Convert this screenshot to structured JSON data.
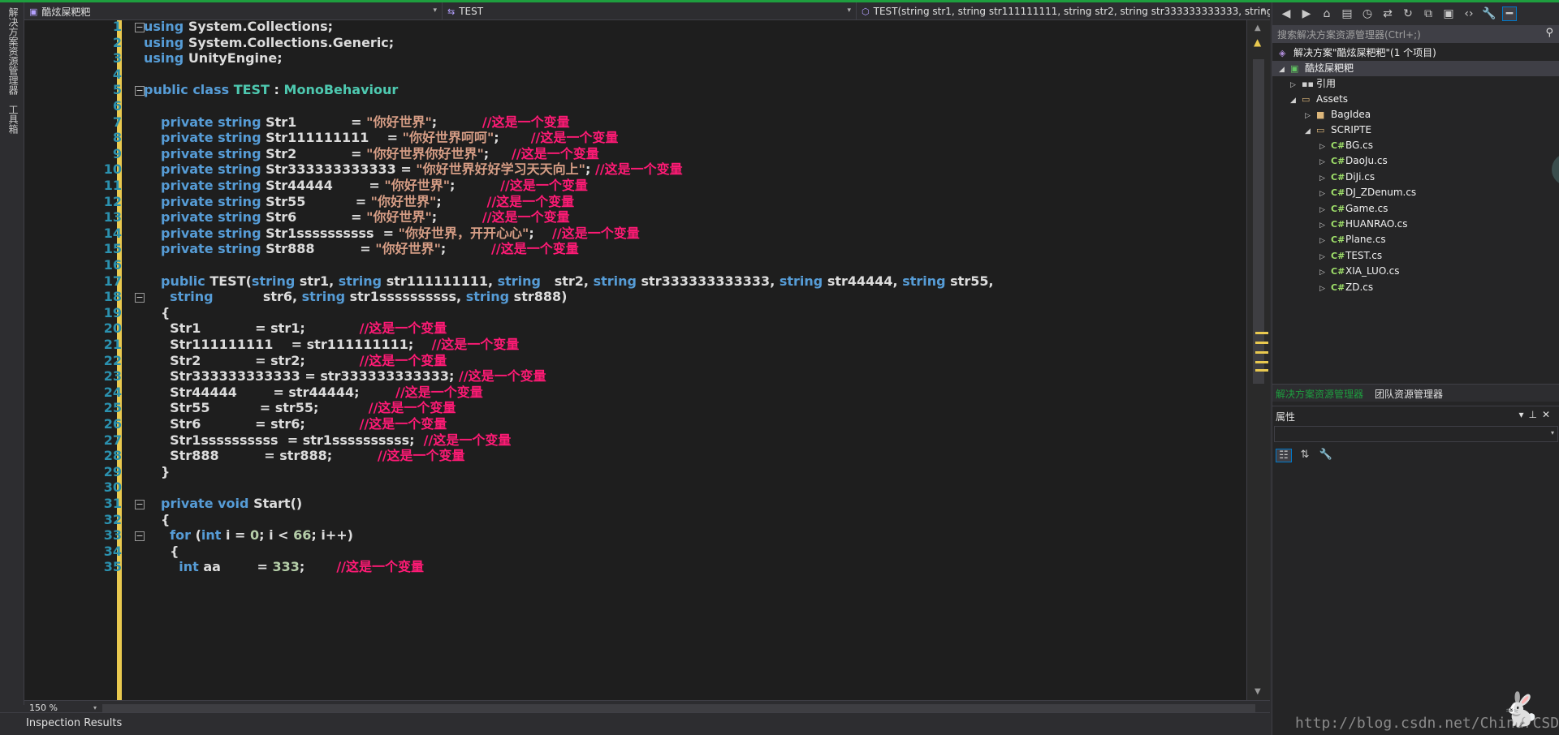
{
  "left_strip": {
    "tab1": "解决方案资源管理器",
    "tab2": "工具箱"
  },
  "navbar": {
    "project": "酷炫屎粑粑",
    "class": "TEST",
    "member": "TEST(string str1, string str111111111, string str2, string str333333333333, string s"
  },
  "lines": [
    [
      {
        "c": "kw",
        "t": "using "
      },
      {
        "c": "txt",
        "t": "System.Collections;"
      }
    ],
    [
      {
        "c": "kw",
        "t": "using "
      },
      {
        "c": "txt",
        "t": "System.Collections.Generic;"
      }
    ],
    [
      {
        "c": "kw",
        "t": "using "
      },
      {
        "c": "txt",
        "t": "UnityEngine;"
      }
    ],
    [],
    [
      {
        "c": "kw",
        "t": "public class "
      },
      {
        "c": "ty",
        "t": "TEST"
      },
      {
        "c": "txt",
        "t": " : "
      },
      {
        "c": "ty",
        "t": "MonoBehaviour"
      }
    ],
    [],
    [
      {
        "c": "kw",
        "t": "private string "
      },
      {
        "c": "txt",
        "t": "Str1            = "
      },
      {
        "c": "str",
        "t": "\"你好世界\""
      },
      {
        "c": "txt",
        "t": ";          "
      },
      {
        "c": "cmt",
        "t": "//这是一个变量"
      }
    ],
    [
      {
        "c": "kw",
        "t": "private string "
      },
      {
        "c": "txt",
        "t": "Str111111111    = "
      },
      {
        "c": "str",
        "t": "\"你好世界呵呵\""
      },
      {
        "c": "txt",
        "t": ";       "
      },
      {
        "c": "cmt",
        "t": "//这是一个变量"
      }
    ],
    [
      {
        "c": "kw",
        "t": "private string "
      },
      {
        "c": "txt",
        "t": "Str2            = "
      },
      {
        "c": "str",
        "t": "\"你好世界你好世界\""
      },
      {
        "c": "txt",
        "t": ";     "
      },
      {
        "c": "cmt",
        "t": "//这是一个变量"
      }
    ],
    [
      {
        "c": "kw",
        "t": "private string "
      },
      {
        "c": "txt",
        "t": "Str333333333333 = "
      },
      {
        "c": "str",
        "t": "\"你好世界好好学习天天向上\""
      },
      {
        "c": "txt",
        "t": "; "
      },
      {
        "c": "cmt",
        "t": "//这是一个变量"
      }
    ],
    [
      {
        "c": "kw",
        "t": "private string "
      },
      {
        "c": "txt",
        "t": "Str44444        = "
      },
      {
        "c": "str",
        "t": "\"你好世界\""
      },
      {
        "c": "txt",
        "t": ";          "
      },
      {
        "c": "cmt",
        "t": "//这是一个变量"
      }
    ],
    [
      {
        "c": "kw",
        "t": "private string "
      },
      {
        "c": "txt",
        "t": "Str55           = "
      },
      {
        "c": "str",
        "t": "\"你好世界\""
      },
      {
        "c": "txt",
        "t": ";          "
      },
      {
        "c": "cmt",
        "t": "//这是一个变量"
      }
    ],
    [
      {
        "c": "kw",
        "t": "private string "
      },
      {
        "c": "txt",
        "t": "Str6            = "
      },
      {
        "c": "str",
        "t": "\"你好世界\""
      },
      {
        "c": "txt",
        "t": ";          "
      },
      {
        "c": "cmt",
        "t": "//这是一个变量"
      }
    ],
    [
      {
        "c": "kw",
        "t": "private string "
      },
      {
        "c": "txt",
        "t": "Str1ssssssssss  = "
      },
      {
        "c": "str",
        "t": "\"你好世界，开开心心\""
      },
      {
        "c": "txt",
        "t": ";    "
      },
      {
        "c": "cmt",
        "t": "//这是一个变量"
      }
    ],
    [
      {
        "c": "kw",
        "t": "private string "
      },
      {
        "c": "txt",
        "t": "Str888          = "
      },
      {
        "c": "str",
        "t": "\"你好世界\""
      },
      {
        "c": "txt",
        "t": ";          "
      },
      {
        "c": "cmt",
        "t": "//这是一个变量"
      }
    ],
    [],
    [
      {
        "c": "kw",
        "t": "public "
      },
      {
        "c": "txt",
        "t": "TEST("
      },
      {
        "c": "kw",
        "t": "string "
      },
      {
        "c": "txt",
        "t": "str1, "
      },
      {
        "c": "kw",
        "t": "string "
      },
      {
        "c": "txt",
        "t": "str111111111, "
      },
      {
        "c": "kw",
        "t": "string   "
      },
      {
        "c": "txt",
        "t": "str2, "
      },
      {
        "c": "kw",
        "t": "string "
      },
      {
        "c": "txt",
        "t": "str333333333333, "
      },
      {
        "c": "kw",
        "t": "string "
      },
      {
        "c": "txt",
        "t": "str44444, "
      },
      {
        "c": "kw",
        "t": "string "
      },
      {
        "c": "txt",
        "t": "str55,"
      }
    ],
    [
      {
        "c": "kw",
        "t": "  string           "
      },
      {
        "c": "txt",
        "t": "str6, "
      },
      {
        "c": "kw",
        "t": "string "
      },
      {
        "c": "txt",
        "t": "str1ssssssssss, "
      },
      {
        "c": "kw",
        "t": "string "
      },
      {
        "c": "txt",
        "t": "str888)"
      }
    ],
    [
      {
        "c": "txt",
        "t": "{"
      }
    ],
    [
      {
        "c": "txt",
        "t": "  Str1            = str1;            "
      },
      {
        "c": "cmt",
        "t": "//这是一个变量"
      }
    ],
    [
      {
        "c": "txt",
        "t": "  Str111111111    = str111111111;    "
      },
      {
        "c": "cmt",
        "t": "//这是一个变量"
      }
    ],
    [
      {
        "c": "txt",
        "t": "  Str2            = str2;            "
      },
      {
        "c": "cmt",
        "t": "//这是一个变量"
      }
    ],
    [
      {
        "c": "txt",
        "t": "  Str333333333333 = str333333333333; "
      },
      {
        "c": "cmt",
        "t": "//这是一个变量"
      }
    ],
    [
      {
        "c": "txt",
        "t": "  Str44444        = str44444;        "
      },
      {
        "c": "cmt",
        "t": "//这是一个变量"
      }
    ],
    [
      {
        "c": "txt",
        "t": "  Str55           = str55;           "
      },
      {
        "c": "cmt",
        "t": "//这是一个变量"
      }
    ],
    [
      {
        "c": "txt",
        "t": "  Str6            = str6;            "
      },
      {
        "c": "cmt",
        "t": "//这是一个变量"
      }
    ],
    [
      {
        "c": "txt",
        "t": "  Str1ssssssssss  = str1ssssssssss;  "
      },
      {
        "c": "cmt",
        "t": "//这是一个变量"
      }
    ],
    [
      {
        "c": "txt",
        "t": "  Str888          = str888;          "
      },
      {
        "c": "cmt",
        "t": "//这是一个变量"
      }
    ],
    [
      {
        "c": "txt",
        "t": "}"
      }
    ],
    [],
    [
      {
        "c": "kw",
        "t": "private void "
      },
      {
        "c": "txt",
        "t": "Start()"
      }
    ],
    [
      {
        "c": "txt",
        "t": "{"
      }
    ],
    [
      {
        "c": "kw",
        "t": "  for "
      },
      {
        "c": "txt",
        "t": "("
      },
      {
        "c": "kw",
        "t": "int "
      },
      {
        "c": "txt",
        "t": "i = "
      },
      {
        "c": "num",
        "t": "0"
      },
      {
        "c": "txt",
        "t": "; i < "
      },
      {
        "c": "num",
        "t": "66"
      },
      {
        "c": "txt",
        "t": "; i++)"
      }
    ],
    [
      {
        "c": "txt",
        "t": "  {"
      }
    ],
    [
      {
        "c": "kw",
        "t": "    int "
      },
      {
        "c": "txt",
        "t": "aa        = "
      },
      {
        "c": "num",
        "t": "333"
      },
      {
        "c": "txt",
        "t": ";       "
      },
      {
        "c": "cmt",
        "t": "//这是一个变量"
      }
    ]
  ],
  "editor_bottom": {
    "zoom": "150 %"
  },
  "bottom_tab": "Inspection Results",
  "solution_explorer": {
    "search_placeholder": "搜索解决方案资源管理器(Ctrl+;)",
    "solution": "解决方案\"酷炫屎粑粑\"(1 个项目)",
    "project": "酷炫屎粑粑",
    "references": "引用",
    "assets": "Assets",
    "bagidea": "BagIdea",
    "scripte": "SCRIPTE",
    "files": [
      "BG.cs",
      "DaoJu.cs",
      "DiJi.cs",
      "DJ_ZDenum.cs",
      "Game.cs",
      "HUANRAO.cs",
      "Plane.cs",
      "TEST.cs",
      "XIA_LUO.cs",
      "ZD.cs"
    ]
  },
  "panel_tabs": {
    "active": "解决方案资源管理器",
    "inactive": "团队资源管理器"
  },
  "properties": {
    "title": "属性"
  },
  "watermark": "http://blog.csdn.net/ChinarCSDN"
}
